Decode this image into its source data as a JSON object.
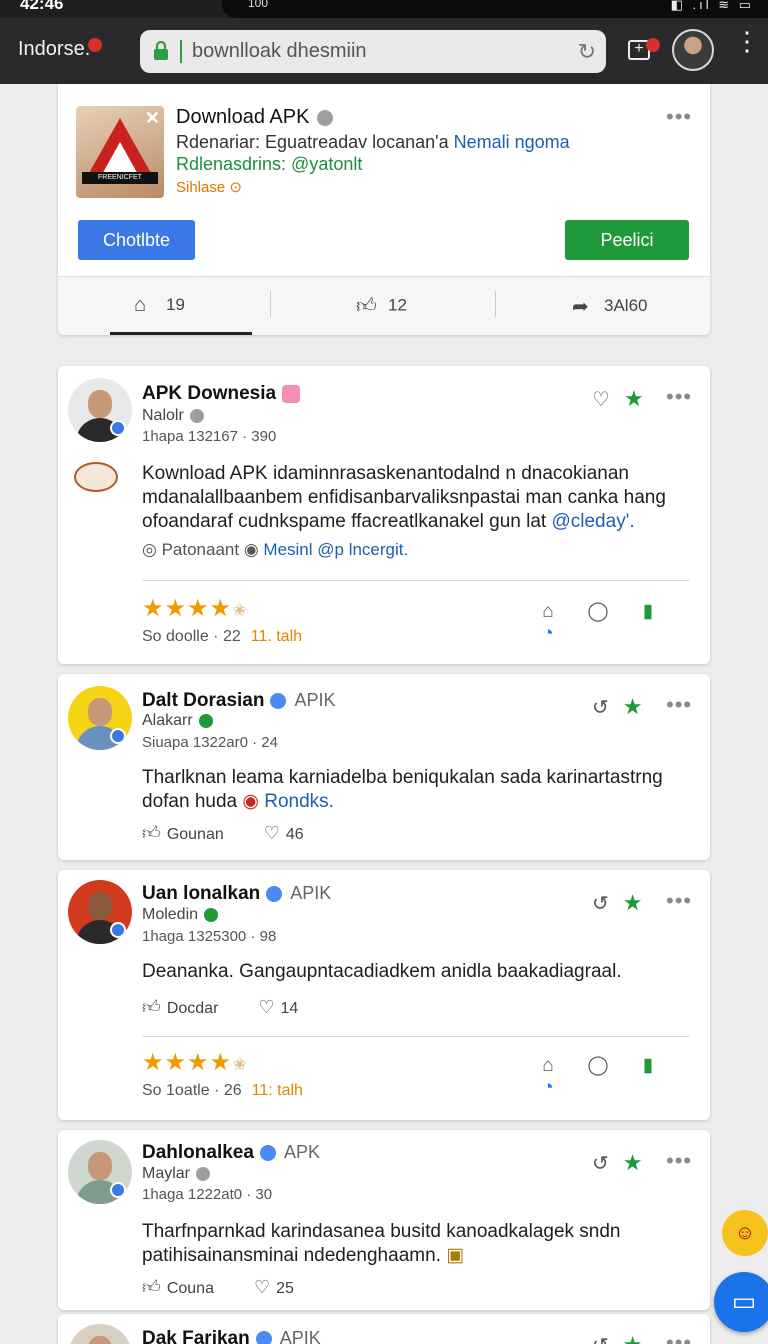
{
  "status": {
    "time": "42:46",
    "notch_label": "100",
    "icons": "◧ .ıl ≋ ▭"
  },
  "browser": {
    "tab_title": "Indorse.",
    "url": "bownlloak dhesmiin",
    "reload_icon": "refresh-icon",
    "add_tab_icon": "add-tab-icon",
    "menu_icon": "kebab-icon"
  },
  "top_card": {
    "thumb_text": "FREENICFET",
    "title": "Download APK",
    "line1_text": "Rdenariar: Eguatreadav locanan'a",
    "line1_link": "Nemali ngoma",
    "line2": "Rdlenasdrins: @yatonlt",
    "line3": "Sihlase ⊙",
    "btn_left": "Chotlbte",
    "btn_right": "Peelici",
    "footer": [
      {
        "icon": "home-icon",
        "count": "19"
      },
      {
        "icon": "thumbs-up-icon",
        "count": "12"
      },
      {
        "icon": "share-icon",
        "count": "3Al60"
      }
    ]
  },
  "posts": [
    {
      "name": "APK Downesia",
      "sub": "Nalolr",
      "meta": "1hapa  132167 · 390",
      "text": "Kownload APK idaminnrasaskenantodalnd n dnacokianan mdanalallbaanbem enfidisanbarvaliksnpastai man canka hang ofoandaraf cudnkspame ffacreatlkanakel gun lat",
      "mention": "@cleday'.",
      "tag_a": "Patonaant",
      "tag_b": "Mesinl @p lncergit.",
      "rating_meta": "So doolle · 22",
      "rating_orange": "11. talh"
    },
    {
      "name": "Dalt Dorasian",
      "tag": "APIK",
      "sub": "Alakarr",
      "meta": "Siuapa  1322ar0 · 24",
      "text": "Tharlknan leama karniadelba beniqukalan sada karinartastrng dofan huda",
      "mention": "Rondks.",
      "action_a": "Gounan",
      "action_b": "46"
    },
    {
      "name": "Uan lonalkan",
      "tag": "APIK",
      "sub": "Moledin",
      "meta": "1haga  1325300 · 98",
      "text": "Deananka. Gangaupntacadiadkem anidla baakadiagraal.",
      "action_a": "Docdar",
      "action_b": "14",
      "rating_meta": "So 1oatle · 26",
      "rating_orange": "11: talh"
    },
    {
      "name": "Dahlonalkea",
      "tag": "APK",
      "sub": "Maylar",
      "meta": "1haga  1222at0 · 30",
      "text": "Tharfnparnkad karindasanea busitd kanoadkalagek sndn patihisainansminai ndedenghaamn.",
      "action_a": "Couna",
      "action_b": "25"
    },
    {
      "name": "Dak Farikan",
      "tag": "APIK"
    }
  ],
  "colors": {
    "accent_blue": "#3b78e7",
    "accent_green": "#1e9a3b",
    "star_orange": "#f29900"
  }
}
